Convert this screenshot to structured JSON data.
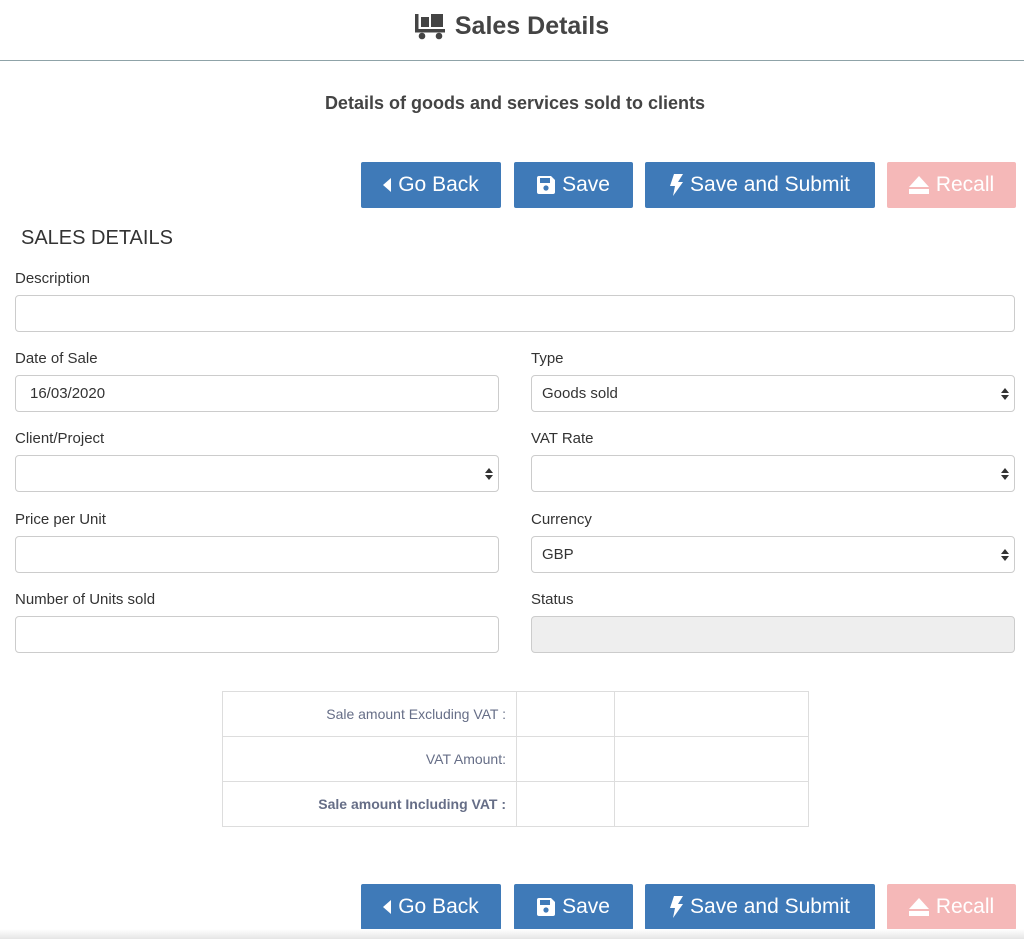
{
  "header": {
    "title": "Sales Details",
    "icon": "dolly-icon"
  },
  "subtitle": "Details of goods and services sold to clients",
  "actions": {
    "go_back": "Go Back",
    "save": "Save",
    "save_submit": "Save and Submit",
    "recall": "Recall"
  },
  "section_title": "SALES DETAILS",
  "form": {
    "description": {
      "label": "Description",
      "value": ""
    },
    "date_of_sale": {
      "label": "Date of Sale",
      "value": "16/03/2020"
    },
    "type": {
      "label": "Type",
      "value": "Goods sold"
    },
    "client_project": {
      "label": "Client/Project",
      "value": ""
    },
    "vat_rate": {
      "label": "VAT Rate",
      "value": ""
    },
    "price_per_unit": {
      "label": "Price per Unit",
      "value": ""
    },
    "currency": {
      "label": "Currency",
      "value": "GBP"
    },
    "units_sold": {
      "label": "Number of Units sold",
      "value": ""
    },
    "status": {
      "label": "Status",
      "value": ""
    }
  },
  "totals": [
    {
      "label": "Sale amount Excluding VAT :",
      "value1": "",
      "value2": "",
      "bold": false
    },
    {
      "label": "VAT Amount:",
      "value1": "",
      "value2": "",
      "bold": false
    },
    {
      "label": "Sale amount Including VAT :",
      "value1": "",
      "value2": "",
      "bold": true
    }
  ],
  "colors": {
    "primary": "#3f7ab8",
    "recall": "#f5b8b8",
    "text": "#333333",
    "totals_text": "#666e87"
  }
}
